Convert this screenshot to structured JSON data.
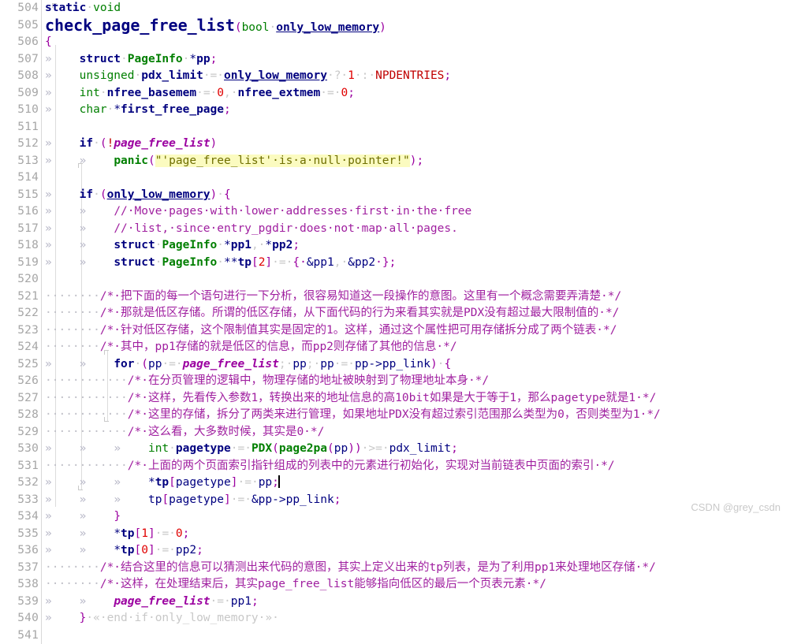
{
  "editor": {
    "first_line": 504,
    "last_line": 541,
    "line_number_suffix": ":",
    "tab_marker": "»",
    "space_marker": "·",
    "cursor_line": 532,
    "watermark": "CSDN @grey_csdn",
    "colors": {
      "background": "#ffffff",
      "line_number": "#a6a6a6",
      "keyword": "#00007f",
      "type": "#007f00",
      "comment": "#a020a0",
      "string": "#6f6f00",
      "string_highlight": "#fbfbc0",
      "number": "#e00000",
      "global_variable": "#9b00a0",
      "macro": "#c00000",
      "whitespace_marker": "#c8c8c8",
      "watermark": "#c9c9c9"
    }
  },
  "lines": [
    {
      "n": 504,
      "text": "static void"
    },
    {
      "n": 505,
      "text": "check_page_free_list(bool only_low_memory)"
    },
    {
      "n": 506,
      "text": "{"
    },
    {
      "n": 507,
      "text": "\tstruct PageInfo *pp;"
    },
    {
      "n": 508,
      "text": "\tunsigned pdx_limit = only_low_memory ? 1 : NPDENTRIES;"
    },
    {
      "n": 509,
      "text": "\tint nfree_basemem = 0, nfree_extmem = 0;"
    },
    {
      "n": 510,
      "text": "\tchar *first_free_page;"
    },
    {
      "n": 511,
      "text": ""
    },
    {
      "n": 512,
      "text": "\tif (!page_free_list)"
    },
    {
      "n": 513,
      "text": "\t\tpanic(\"'page_free_list' is a null pointer!\");"
    },
    {
      "n": 514,
      "text": ""
    },
    {
      "n": 515,
      "text": "\tif (only_low_memory) {"
    },
    {
      "n": 516,
      "text": "\t\t// Move pages with lower addresses first in the free"
    },
    {
      "n": 517,
      "text": "\t\t// list, since entry_pgdir does not map all pages."
    },
    {
      "n": 518,
      "text": "\t\tstruct PageInfo *pp1, *pp2;"
    },
    {
      "n": 519,
      "text": "\t\tstruct PageInfo **tp[2] = { &pp1, &pp2 };"
    },
    {
      "n": 520,
      "text": ""
    },
    {
      "n": 521,
      "text": "        /* 把下面的每一个语句进行一下分析，很容易知道这一段操作的意图。这里有一个概念需要弄清楚 */"
    },
    {
      "n": 522,
      "text": "        /* 那就是低区存储。所谓的低区存储，从下面代码的行为来看其实就是PDX没有超过最大限制值的 */"
    },
    {
      "n": 523,
      "text": "        /* 针对低区存储，这个限制值其实是固定的1。这样，通过这个属性把可用存储拆分成了两个链表 */"
    },
    {
      "n": 524,
      "text": "        /* 其中，pp1存储的就是低区的信息，而pp2则存储了其他的信息 */"
    },
    {
      "n": 525,
      "text": "\t\tfor (pp = page_free_list; pp; pp = pp->pp_link) {"
    },
    {
      "n": 526,
      "text": "            /* 在分页管理的逻辑中，物理存储的地址被映射到了物理地址本身 */"
    },
    {
      "n": 527,
      "text": "            /* 这样，先看传入参数1，转换出来的地址信息的高10bit如果是大于等于1，那么pagetype就是1 */"
    },
    {
      "n": 528,
      "text": "            /* 这里的存储，拆分了两类来进行管理，如果地址PDX没有超过索引范围那么类型为0，否则类型为1 */"
    },
    {
      "n": 529,
      "text": "            /* 这么看，大多数时候，其实是0 */"
    },
    {
      "n": 530,
      "text": "\t\t\tint pagetype = PDX(page2pa(pp)) >= pdx_limit;"
    },
    {
      "n": 531,
      "text": "            /* 上面的两个页面索引指针组成的列表中的元素进行初始化，实现对当前链表中页面的索引 */"
    },
    {
      "n": 532,
      "text": "\t\t\t*tp[pagetype] = pp;"
    },
    {
      "n": 533,
      "text": "\t\t\ttp[pagetype] = &pp->pp_link;"
    },
    {
      "n": 534,
      "text": "\t\t}"
    },
    {
      "n": 535,
      "text": "\t\t*tp[1] = 0;"
    },
    {
      "n": 536,
      "text": "\t\t*tp[0] = pp2;"
    },
    {
      "n": 537,
      "text": "        /* 结合这里的信息可以猜测出来代码的意图，其实上定义出来的tp列表，是为了利用pp1来处理地区存储 */"
    },
    {
      "n": 538,
      "text": "        /* 这样，在处理结束后，其实page_free_list能够指向低区的最后一个页表元素 */"
    },
    {
      "n": 539,
      "text": "\t\tpage_free_list = pp1;"
    },
    {
      "n": 540,
      "text": "\t} « end if only_low_memory »"
    },
    {
      "n": 541,
      "text": ""
    }
  ],
  "tokens": {
    "l504": [
      {
        "t": "static",
        "c": "kw"
      },
      {
        "t": "·",
        "c": "sp"
      },
      {
        "t": "void",
        "c": "type"
      }
    ],
    "l505_name": "check_page_free_list",
    "l505_paren_open": "(",
    "l505_bool": "bool",
    "l505_space": "·",
    "l505_param": "only_low_memory",
    "l505_paren_close": ")",
    "l506": "{",
    "l507": {
      "tab": "»",
      "kw": "struct",
      "sp": "·",
      "type": "PageInfo",
      "sp2": "·",
      "star": "*",
      "var": "pp",
      "semi": ";"
    },
    "l508": {
      "tab": "»",
      "type": "unsigned",
      "sp": "·",
      "var": "pdx_limit",
      "eq": "·=·",
      "param": "only_low_memory",
      "q": "·?·",
      "one": "1",
      "colon": "·:·",
      "macro": "NPDENTRIES",
      "semi": ";"
    },
    "l509": {
      "tab": "»",
      "type": "int",
      "sp": "·",
      "v1": "nfree_basemem",
      "eq": "·=·",
      "z1": "0",
      "comma": ",·",
      "v2": "nfree_extmem",
      "eq2": "·=·",
      "z2": "0",
      "semi": ";"
    },
    "l510": {
      "tab": "»",
      "type": "char",
      "sp": "·",
      "star": "*",
      "var": "first_free_page",
      "semi": ";"
    },
    "l512": {
      "tab": "»",
      "kw": "if",
      "sp": "·",
      "po": "(",
      "bang": "!",
      "glob": "page_free_list",
      "pc": ")"
    },
    "l513": {
      "tab": "»",
      "tab2": "»",
      "call": "panic",
      "po": "(",
      "str": "\"'page_free_list'·is·a·null·pointer!\"",
      "pc": ")",
      "semi": ";"
    },
    "l515": {
      "tab": "»",
      "kw": "if",
      "sp": "·",
      "po": "(",
      "param": "only_low_memory",
      "pc": ")",
      "sp2": "·",
      "brace": "{"
    },
    "l516": {
      "tab": "»",
      "tab2": "»",
      "cmt": "//·Move·pages·with·lower·addresses·first·in·the·free"
    },
    "l517": {
      "tab": "»",
      "tab2": "»",
      "cmt": "//·list,·since·entry_pgdir·does·not·map·all·pages."
    },
    "l518": {
      "tab": "»",
      "tab2": "»",
      "kw": "struct",
      "sp": "·",
      "type": "PageInfo",
      "sp2": "·",
      "s1": "*",
      "v1": "pp1",
      "comma": ",·",
      "s2": "*",
      "v2": "pp2",
      "semi": ";"
    },
    "l519": {
      "tab": "»",
      "tab2": "»",
      "kw": "struct",
      "sp": "·",
      "type": "PageInfo",
      "sp2": "·",
      "stars": "**",
      "var": "tp",
      "br1": "[",
      "two": "2",
      "br2": "]",
      "eq": "·=·",
      "bo": "{·",
      "a1": "&pp1",
      "comma": ",·",
      "a2": "&pp2",
      "bc": "·}",
      "semi": ";"
    },
    "l521": {
      "ind": "········",
      "cmt": "/*·把下面的每一个语句进行一下分析，很容易知道这一段操作的意图。这里有一个概念需要弄清楚·*/"
    },
    "l522": {
      "ind": "········",
      "cmt": "/*·那就是低区存储。所谓的低区存储，从下面代码的行为来看其实就是PDX没有超过最大限制值的·*/"
    },
    "l523": {
      "ind": "········",
      "cmt": "/*·针对低区存储，这个限制值其实是固定的1。这样，通过这个属性把可用存储拆分成了两个链表·*/"
    },
    "l524": {
      "ind": "········",
      "cmt": "/*·其中，pp1存储的就是低区的信息，而pp2则存储了其他的信息·*/"
    },
    "l525": {
      "tab": "»",
      "tab2": "»",
      "kw": "for",
      "sp": "·",
      "po": "(",
      "v": "pp",
      "eq": "·=·",
      "glob": "page_free_list",
      "semi1": ";·",
      "v2": "pp",
      "semi2": ";·",
      "v3": "pp",
      "eq2": "·=·",
      "expr": "pp->pp_link",
      "pc": ")",
      "sp2": "·",
      "brace": "{"
    },
    "l526": {
      "ind": "············",
      "cmt": "/*·在分页管理的逻辑中，物理存储的地址被映射到了物理地址本身·*/"
    },
    "l527": {
      "ind": "············",
      "cmt": "/*·这样，先看传入参数1，转换出来的地址信息的高10bit如果是大于等于1，那么pagetype就是1·*/"
    },
    "l528": {
      "ind": "············",
      "cmt": "/*·这里的存储，拆分了两类来进行管理，如果地址PDX没有超过索引范围那么类型为0，否则类型为1·*/"
    },
    "l529": {
      "ind": "············",
      "cmt": "/*·这么看，大多数时候，其实是0·*/"
    },
    "l530": {
      "tab": "»",
      "tab2": "»",
      "tab3": "»",
      "type": "int",
      "sp": "·",
      "var": "pagetype",
      "eq": "·=·",
      "call": "PDX",
      "po": "(",
      "call2": "page2pa",
      "po2": "(",
      "arg": "pp",
      "pc2": ")",
      "pc": ")",
      "ge": "·>=·",
      "v": "pdx_limit",
      "semi": ";"
    },
    "l531": {
      "ind": "············",
      "cmt": "/*·上面的两个页面索引指针组成的列表中的元素进行初始化，实现对当前链表中页面的索引·*/"
    },
    "l532": {
      "tab": "»",
      "tab2": "»",
      "tab3": "»",
      "star": "*",
      "var": "tp",
      "br1": "[",
      "idx": "pagetype",
      "br2": "]",
      "eq": "·=·",
      "val": "pp",
      "semi": ";"
    },
    "l533": {
      "tab": "»",
      "tab2": "»",
      "tab3": "»",
      "var": "tp",
      "br1": "[",
      "idx": "pagetype",
      "br2": "]",
      "eq": "·=·",
      "val": "&pp->pp_link",
      "semi": ";"
    },
    "l534": {
      "tab": "»",
      "tab2": "»",
      "brace": "}"
    },
    "l535": {
      "tab": "»",
      "tab2": "»",
      "star": "*",
      "var": "tp",
      "br1": "[",
      "idx": "1",
      "br2": "]",
      "eq": "·=·",
      "val": "0",
      "semi": ";"
    },
    "l536": {
      "tab": "»",
      "tab2": "»",
      "star": "*",
      "var": "tp",
      "br1": "[",
      "idx": "0",
      "br2": "]",
      "eq": "·=·",
      "val": "pp2",
      "semi": ";"
    },
    "l537": {
      "ind": "········",
      "cmt": "/*·结合这里的信息可以猜测出来代码的意图，其实上定义出来的tp列表，是为了利用pp1来处理地区存储·*/"
    },
    "l538": {
      "ind": "········",
      "cmt": "/*·这样，在处理结束后，其实page_free_list能够指向低区的最后一个页表元素·*/"
    },
    "l539": {
      "tab": "»",
      "tab2": "»",
      "glob": "page_free_list",
      "eq": "·=·",
      "val": "pp1",
      "semi": ";"
    },
    "l540": {
      "tab": "»",
      "brace": "}",
      "tail": "·«·end·if·only_low_memory·»·"
    }
  }
}
